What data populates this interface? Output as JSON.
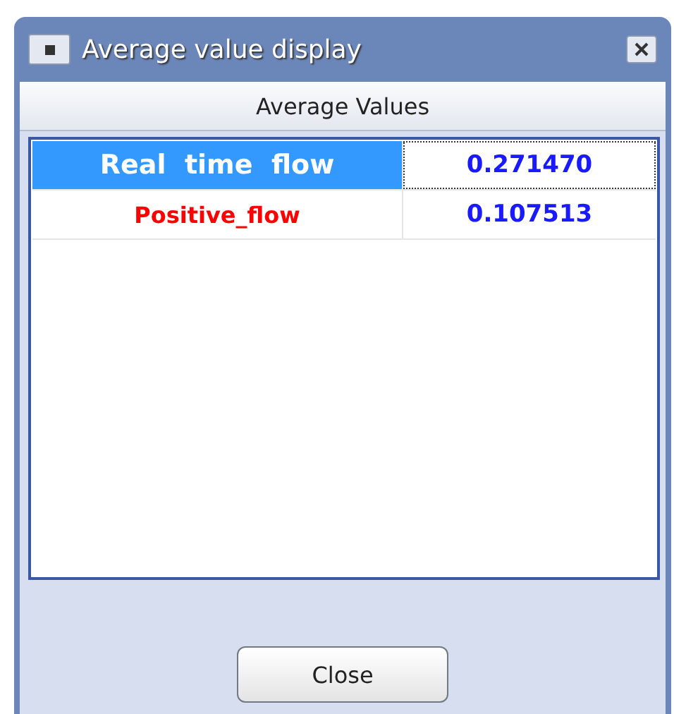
{
  "window": {
    "title": "Average value display"
  },
  "table": {
    "header": "Average Values",
    "rows": [
      {
        "name": "Real  time  flow",
        "value": "0.271470",
        "selected": true,
        "focused": true
      },
      {
        "name": "Positive_flow",
        "value": "0.107513",
        "selected": false,
        "focused": false
      }
    ]
  },
  "buttons": [
    {
      "label": "Close"
    }
  ]
}
